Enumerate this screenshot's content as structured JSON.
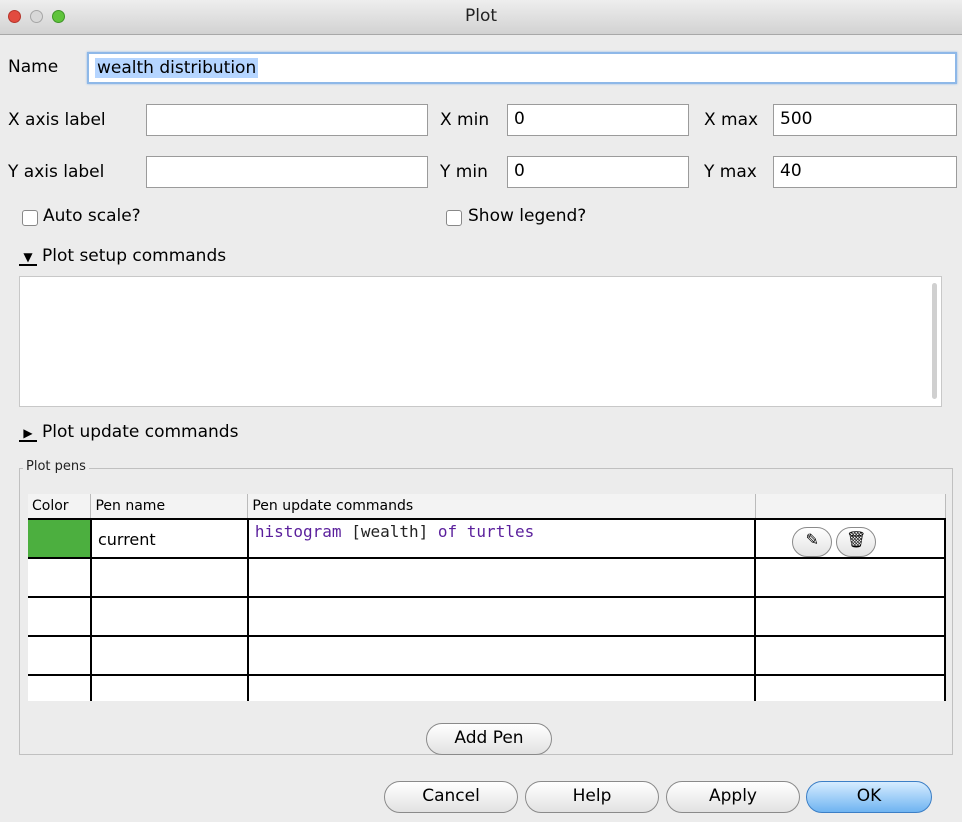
{
  "window": {
    "title": "Plot"
  },
  "form": {
    "name_label": "Name",
    "name_value": "wealth distribution",
    "x_axis_label": "X axis label",
    "x_axis_value": "",
    "x_min_label": "X min",
    "x_min_value": "0",
    "x_max_label": "X max",
    "x_max_value": "500",
    "y_axis_label": "Y axis label",
    "y_axis_value": "",
    "y_min_label": "Y min",
    "y_min_value": "0",
    "y_max_label": "Y max",
    "y_max_value": "40",
    "auto_scale_label": "Auto scale?",
    "auto_scale_checked": false,
    "show_legend_label": "Show legend?",
    "show_legend_checked": false
  },
  "setup": {
    "label": "Plot setup commands",
    "commands": ""
  },
  "update": {
    "label": "Plot update commands"
  },
  "pens": {
    "group_label": "Plot pens",
    "columns": [
      "Color",
      "Pen name",
      "Pen update commands",
      ""
    ],
    "rows": [
      {
        "color": "#4caf3f",
        "name": "current",
        "command": {
          "kw1": "histogram",
          "arg": "[wealth]",
          "kw2": "of turtles"
        }
      }
    ],
    "add_label": "Add Pen"
  },
  "footer": {
    "cancel": "Cancel",
    "help": "Help",
    "apply": "Apply",
    "ok": "OK"
  },
  "icons": {
    "edit": "pencil-icon",
    "delete": "trash-icon"
  }
}
